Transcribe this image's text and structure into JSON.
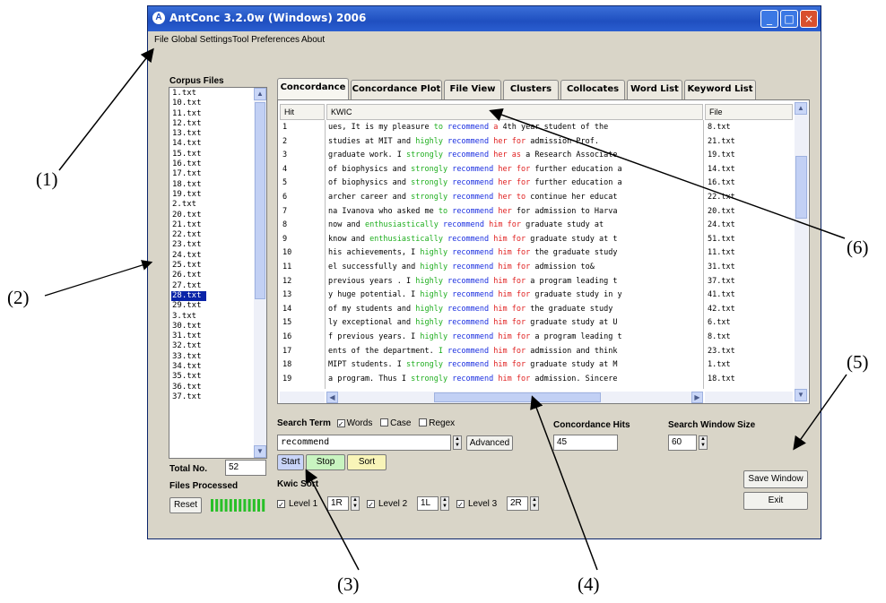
{
  "window": {
    "title": "AntConc 3.2.0w (Windows) 2006",
    "minimize_icon": "minimize-icon",
    "maximize_icon": "maximize-icon",
    "close_icon": "close-icon"
  },
  "menu": {
    "file": "File",
    "global": "Global Settings",
    "tool": "Tool Preferences",
    "about": "About"
  },
  "corpus": {
    "label": "Corpus Files",
    "files": [
      "1.txt",
      "10.txt",
      "11.txt",
      "12.txt",
      "13.txt",
      "14.txt",
      "15.txt",
      "16.txt",
      "17.txt",
      "18.txt",
      "19.txt",
      "2.txt",
      "20.txt",
      "21.txt",
      "22.txt",
      "23.txt",
      "24.txt",
      "25.txt",
      "26.txt",
      "27.txt",
      "28.txt",
      "29.txt",
      "3.txt",
      "30.txt",
      "31.txt",
      "32.txt",
      "33.txt",
      "34.txt",
      "35.txt",
      "36.txt",
      "37.txt"
    ],
    "selected_index": 20,
    "total_label": "Total No.",
    "total_value": "52",
    "processed_label": "Files Processed",
    "reset_label": "Reset"
  },
  "tabs": [
    "Concordance",
    "Concordance Plot",
    "File View",
    "Clusters",
    "Collocates",
    "Word List",
    "Keyword List"
  ],
  "active_tab": 0,
  "table": {
    "hit_header": "Hit",
    "kwic_header": "KWIC",
    "file_header": "File",
    "rows": [
      {
        "hit": "1",
        "left": "ues,  It is my pleasure ",
        "l1": "to",
        "kw": " recommend",
        "r1": " a",
        "right": " 4th year student of the",
        "file": "8.txt"
      },
      {
        "hit": "2",
        "left": " studies at MIT and ",
        "l1": "highly",
        "kw": " recommend",
        "r1": " her for",
        "right": " admission    Prof.",
        "file": "21.txt"
      },
      {
        "hit": "3",
        "left": " graduate work. I ",
        "l1": "strongly",
        "kw": " recommend",
        "r1": " her as",
        "right": " a Research Associate",
        "file": "19.txt"
      },
      {
        "hit": "4",
        "left": "of biophysics and ",
        "l1": "strongly",
        "kw": " recommend",
        "r1": " her for",
        "right": " further education a",
        "file": "14.txt"
      },
      {
        "hit": "5",
        "left": "of biophysics and ",
        "l1": "strongly",
        "kw": " recommend",
        "r1": " her for",
        "right": " further education a",
        "file": "16.txt"
      },
      {
        "hit": "6",
        "left": "archer career and ",
        "l1": "strongly",
        "kw": " recommend",
        "r1": " her to",
        "right": " continue her educat",
        "file": "22.txt"
      },
      {
        "hit": "7",
        "left": "na Ivanova who asked me ",
        "l1": "to",
        "kw": " recommend",
        "r1": " her",
        "right": " for admission to Harva",
        "file": "20.txt"
      },
      {
        "hit": "8",
        "left": "now and  ",
        "l1": "enthusiastically",
        "kw": "  recommend",
        "r1": "  him  for",
        "right": " graduate study at",
        "file": "24.txt"
      },
      {
        "hit": "9",
        "left": " know and ",
        "l1": "enthusiastically",
        "kw": " recommend",
        "r1": " him for",
        "right": " graduate study at t",
        "file": "51.txt"
      },
      {
        "hit": "10",
        "left": "his achievements, I ",
        "l1": "highly",
        "kw": " recommend",
        "r1": " him for",
        "right": " the graduate study",
        "file": "11.txt"
      },
      {
        "hit": "11",
        "left": "el successfully and ",
        "l1": "highly",
        "kw": " recommend",
        "r1": " him for",
        "right": " admission to&",
        "file": "31.txt"
      },
      {
        "hit": "12",
        "left": " previous years . I ",
        "l1": "highly",
        "kw": " recommend",
        "r1": " him for",
        "right": " a program leading t",
        "file": "37.txt"
      },
      {
        "hit": "13",
        "left": "y huge potential. I ",
        "l1": "highly",
        "kw": " recommend",
        "r1": " him for",
        "right": " graduate study in y",
        "file": "41.txt"
      },
      {
        "hit": "14",
        "left": " of my students and ",
        "l1": "highly",
        "kw": " recommend",
        "r1": " him for",
        "right": " the graduate study",
        "file": "42.txt"
      },
      {
        "hit": "15",
        "left": "ly exceptional and ",
        "l1": "highly",
        "kw": " recommend",
        "r1": " him for",
        "right": " graduate study at U",
        "file": "6.txt"
      },
      {
        "hit": "16",
        "left": "f previous years. I ",
        "l1": "highly",
        "kw": " recommend",
        "r1": " him for",
        "right": " a program leading t",
        "file": "8.txt"
      },
      {
        "hit": "17",
        "left": "ents of the department.  ",
        "l1": "I",
        "kw": " recommend",
        "r1": " him for",
        "right": " admission and think",
        "file": "23.txt"
      },
      {
        "hit": "18",
        "left": " MIPT students. I ",
        "l1": "strongly",
        "kw": " recommend",
        "r1": " him for",
        "right": " graduate study at M",
        "file": "1.txt"
      },
      {
        "hit": "19",
        "left": "a program.  Thus I ",
        "l1": "strongly",
        "kw": " recommend",
        "r1": " him for",
        "right": " admission.  Sincere",
        "file": "18.txt"
      }
    ]
  },
  "search": {
    "label": "Search Term",
    "words_label": "Words",
    "case_label": "Case",
    "regex_label": "Regex",
    "term": "recommend",
    "advanced_label": "Advanced",
    "start_label": "Start",
    "stop_label": "Stop",
    "sort_label": "Sort",
    "hits_label": "Concordance Hits",
    "hits_value": "45",
    "window_label": "Search Window Size",
    "window_value": "60"
  },
  "kwic_sort": {
    "label": "Kwic Sort",
    "level1_label": "Level 1",
    "level1_value": "1R",
    "level2_label": "Level 2",
    "level2_value": "1L",
    "level3_label": "Level 3",
    "level3_value": "2R"
  },
  "buttons": {
    "save_window": "Save Window",
    "exit": "Exit"
  },
  "annotations": [
    "(1)",
    "(2)",
    "(3)",
    "(4)",
    "(5)",
    "(6)"
  ],
  "colors": {
    "titlebar": "#1f4fc0",
    "keyword": "#1a2ee0",
    "left_collocate": "#1fae1f",
    "right_collocate": "#e02020",
    "start_button": "#c8d4f8",
    "stop_button": "#c8f4c0",
    "sort_button": "#f8f4b8",
    "progress": "#28c028"
  }
}
